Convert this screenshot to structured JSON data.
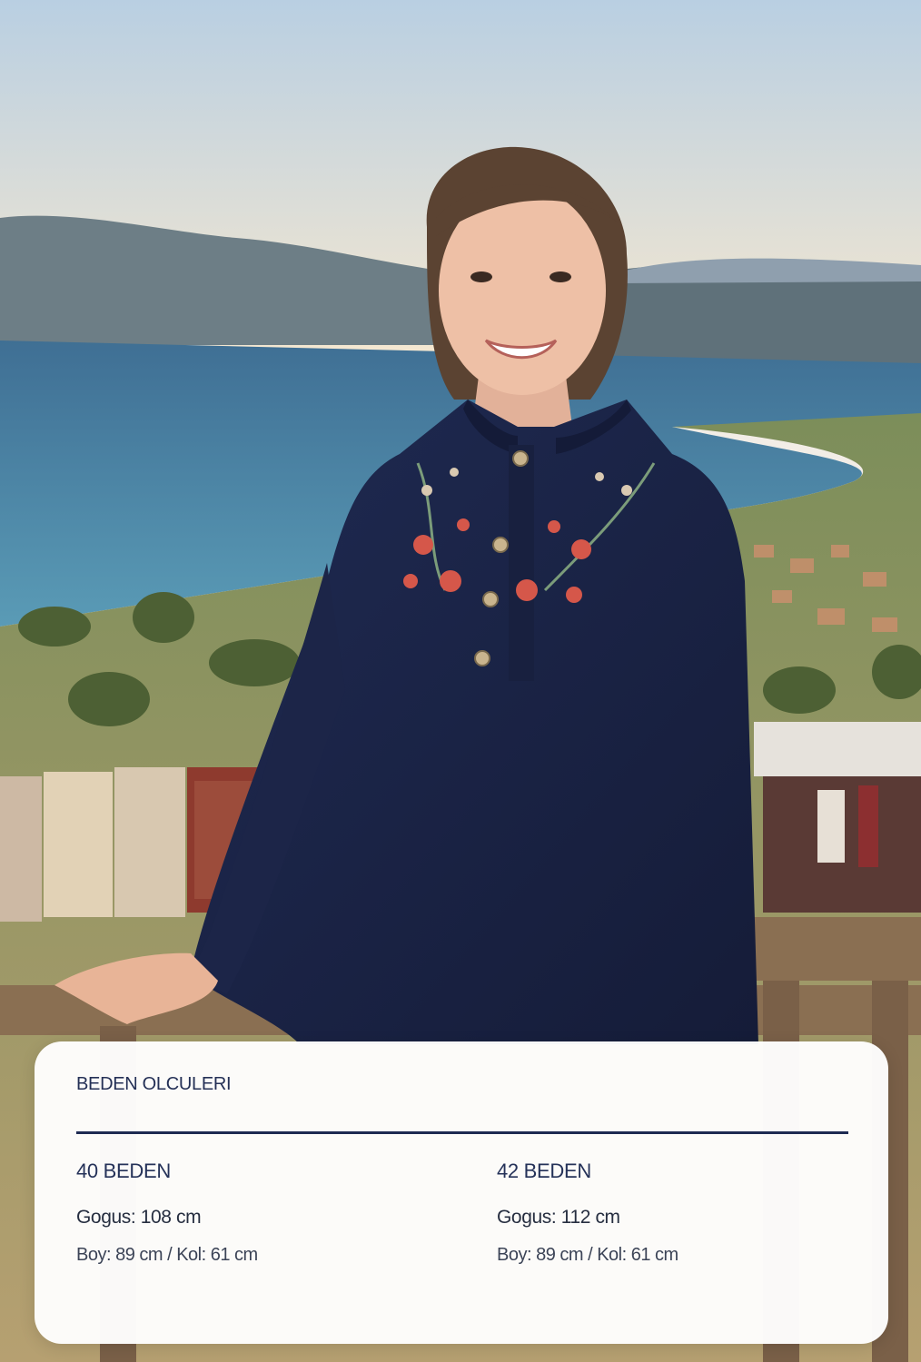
{
  "card": {
    "title": "BEDEN OLCULERI",
    "sizes": [
      {
        "name": "40 BEDEN",
        "chest": "Gogus: 108 cm",
        "body": "Boy: 89 cm / Kol: 61 cm"
      },
      {
        "name": "42 BEDEN",
        "chest": "Gogus: 112 cm",
        "body": "Boy: 89 cm / Kol: 61 cm"
      }
    ]
  },
  "colors": {
    "sky_top": "#b9cfe2",
    "sky_bottom": "#f6e8d0",
    "sea": "#3f6f94",
    "blouse": "#1b2344",
    "card_title": "#243056",
    "divider": "#1d2a52"
  },
  "icons": {
    "photo": "portrait-photo"
  }
}
